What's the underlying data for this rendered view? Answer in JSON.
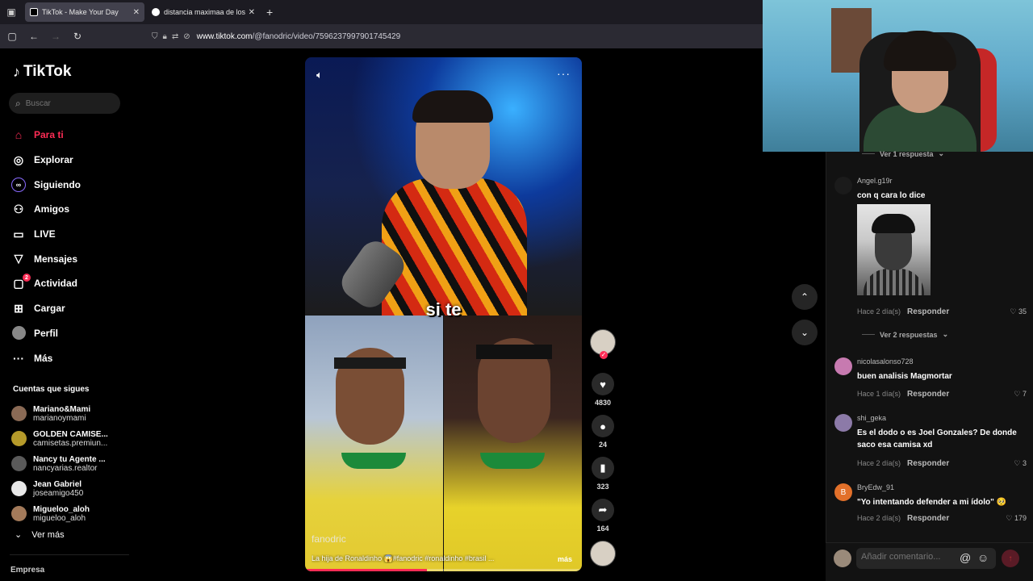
{
  "browser": {
    "tabs": [
      {
        "title": "TikTok - Make Your Day",
        "active": true
      },
      {
        "title": "distancia maximaa de los misile",
        "active": false
      }
    ],
    "url_host": "www.tiktok.com",
    "url_path": "/@fanodric/video/7596237997901745429"
  },
  "sidebar": {
    "logo": "TikTok",
    "search_placeholder": "Buscar",
    "menu": [
      {
        "label": "Para ti",
        "icon": "home-icon",
        "active": true
      },
      {
        "label": "Explorar",
        "icon": "compass-icon"
      },
      {
        "label": "Siguiendo",
        "icon": "following-icon"
      },
      {
        "label": "Amigos",
        "icon": "friends-icon"
      },
      {
        "label": "LIVE",
        "icon": "live-icon"
      },
      {
        "label": "Mensajes",
        "icon": "messages-icon"
      },
      {
        "label": "Actividad",
        "icon": "activity-icon",
        "badge": "2"
      },
      {
        "label": "Cargar",
        "icon": "upload-icon"
      },
      {
        "label": "Perfil",
        "icon": "profile-avatar"
      },
      {
        "label": "Más",
        "icon": "more-icon"
      }
    ],
    "following_title": "Cuentas que sigues",
    "following": [
      {
        "name": "Mariano&Mami",
        "handle": "marianoymami",
        "color": "#8a6a55"
      },
      {
        "name": "GOLDEN CAMISE...",
        "handle": "camisetas.premiun...",
        "color": "#b59a2a"
      },
      {
        "name": "Nancy tu Agente ...",
        "handle": "nancyarias.realtor",
        "color": "#5a5a5a"
      },
      {
        "name": "Jean Gabriel",
        "handle": "joseamigo450",
        "color": "#e8e8e8"
      },
      {
        "name": "Migueloo_aloh",
        "handle": "migueloo_aloh",
        "color": "#a37a5a"
      }
    ],
    "see_more": "Ver más",
    "company": "Empresa"
  },
  "video": {
    "caption_word": "si te",
    "author": "fanodric",
    "description": "La hija de Ronaldinho 😱#fanodric #ronaldinho #brasil ...",
    "more": "más",
    "progress": 0.44
  },
  "actions": {
    "likes": "4830",
    "comments": "24",
    "saves": "323",
    "shares": "164"
  },
  "comments": {
    "top_reply_toggle": "Ver 1 respuesta",
    "items": [
      {
        "user": "Angel.g19r",
        "text": "con q cara lo dice",
        "time": "Hace 2 día(s)",
        "reply": "Responder",
        "likes": "35",
        "has_photo": true,
        "color": "#1b1b1b"
      },
      {
        "user": "nicolasalonso728",
        "text": "buen analisis Magmortar",
        "time": "Hace 1 día(s)",
        "reply": "Responder",
        "likes": "7",
        "color": "#c77ab0"
      },
      {
        "user": "shi_geka",
        "text": "Es el dodo o es Joel Gonzales? De donde saco esa camisa xd",
        "time": "Hace 2 día(s)",
        "reply": "Responder",
        "likes": "3",
        "color": "#8c7aa8"
      },
      {
        "user": "BryEdw_91",
        "text": "\"Yo intentando defender a mi ídolo\" 🥺",
        "time": "Hace 2 día(s)",
        "reply": "Responder",
        "likes": "179",
        "color": "#e2702a",
        "initial": "B"
      }
    ],
    "reply_toggle_2": "Ver 2 respuestas",
    "compose_placeholder": "Añadir comentario..."
  }
}
